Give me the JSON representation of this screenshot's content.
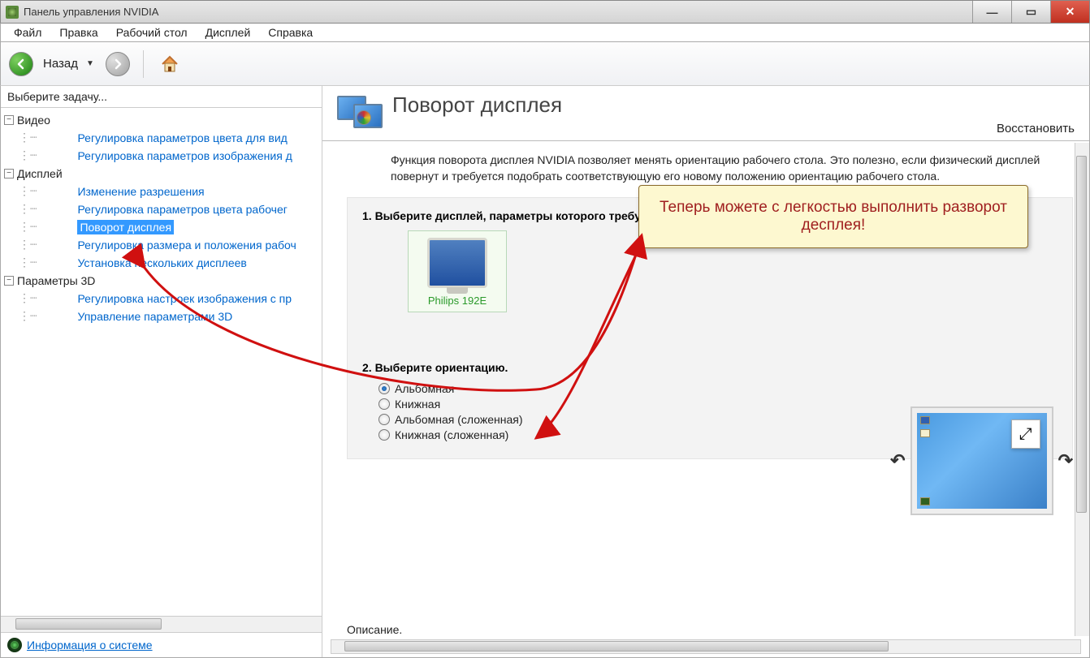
{
  "window": {
    "title": "Панель управления NVIDIA"
  },
  "menu": {
    "file": "Файл",
    "edit": "Правка",
    "desktop": "Рабочий стол",
    "display": "Дисплей",
    "help": "Справка"
  },
  "toolbar": {
    "back": "Назад"
  },
  "sidebar": {
    "title": "Выберите задачу...",
    "video": {
      "label": "Видео",
      "items": [
        "Регулировка параметров цвета для вид",
        "Регулировка параметров изображения д"
      ]
    },
    "display": {
      "label": "Дисплей",
      "items": [
        "Изменение разрешения",
        "Регулировка параметров цвета рабочег",
        "Поворот дисплея",
        "Регулировка размера и положения рабоч",
        "Установка нескольких дисплеев"
      ]
    },
    "params3d": {
      "label": "Параметры 3D",
      "items": [
        "Регулировка настроек изображения с пр",
        "Управление параметрами 3D"
      ]
    },
    "sysinfo": "Информация о системе"
  },
  "content": {
    "title": "Поворот дисплея",
    "restore": "Восстановить",
    "description": "Функция поворота дисплея NVIDIA позволяет менять ориентацию рабочего стола. Это полезно, если физический дисплей повернут и требуется подобрать соответствующую его новому положению ориентацию рабочего стола.",
    "step1": "1. Выберите дисплей, параметры которого требуется изменить.",
    "display_name": "Philips 192E",
    "step2": "2. Выберите ориентацию.",
    "orientations": [
      "Альбомная",
      "Книжная",
      "Альбомная (сложенная)",
      "Книжная (сложенная)"
    ],
    "selected_orientation": 0,
    "desc_footer": "Описание."
  },
  "callout": {
    "text": "Теперь можете с легкостью выполнить разворот десплея!"
  }
}
